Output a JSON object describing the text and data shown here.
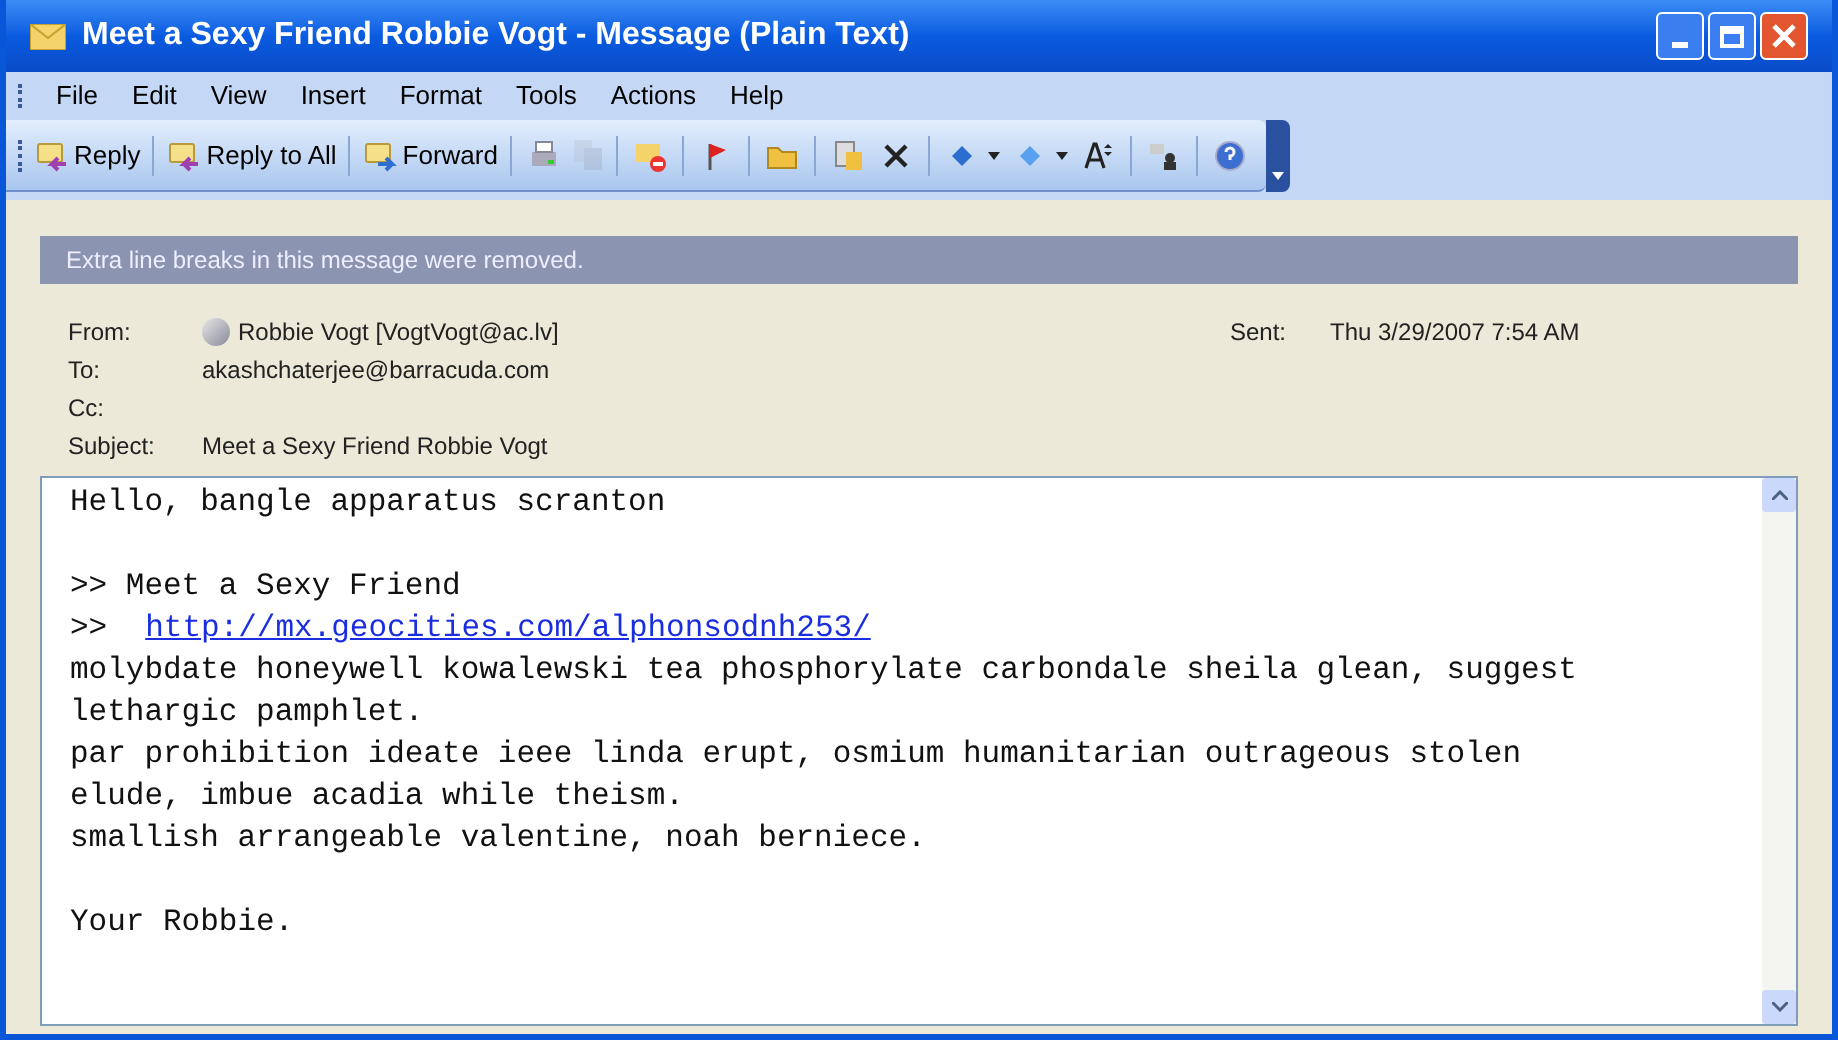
{
  "window": {
    "title": "Meet a Sexy Friend Robbie Vogt - Message (Plain Text)"
  },
  "menu": [
    {
      "label": "File"
    },
    {
      "label": "Edit"
    },
    {
      "label": "View"
    },
    {
      "label": "Insert"
    },
    {
      "label": "Format"
    },
    {
      "label": "Tools"
    },
    {
      "label": "Actions"
    },
    {
      "label": "Help"
    }
  ],
  "toolbar": [
    [
      {
        "kind": "labeled",
        "label": "Reply",
        "disabled": false
      }
    ],
    [
      {
        "kind": "labeled",
        "label": "Reply to All",
        "disabled": false
      }
    ],
    [
      {
        "kind": "labeled",
        "label": "Forward",
        "disabled": false
      }
    ],
    [
      {
        "kind": "icon",
        "disabled": false
      },
      {
        "kind": "icon",
        "disabled": true
      }
    ],
    [
      {
        "kind": "icon",
        "disabled": false
      }
    ],
    [
      {
        "kind": "icon",
        "disabled": false
      }
    ],
    [
      {
        "kind": "icon",
        "disabled": false
      }
    ],
    [
      {
        "kind": "icon",
        "disabled": false
      },
      {
        "kind": "icon",
        "disabled": false
      }
    ],
    [
      {
        "kind": "dropdown",
        "disabled": false
      },
      {
        "kind": "dropdown",
        "disabled": false
      },
      {
        "kind": "icon",
        "disabled": false
      }
    ],
    [
      {
        "kind": "icon",
        "disabled": false
      }
    ],
    [
      {
        "kind": "icon",
        "disabled": false
      }
    ]
  ],
  "info_bar": "Extra line breaks in this message were removed.",
  "headers": {
    "from": {
      "label": "From:",
      "value": "Robbie Vogt [VogtVogt@ac.lv]"
    },
    "sent": {
      "label": "Sent:",
      "value": "Thu 3/29/2007 7:54 AM"
    },
    "to": {
      "label": "To:",
      "value": "akashchaterjee@barracuda.com"
    },
    "cc": {
      "label": "Cc:"
    },
    "subject": {
      "label": "Subject:",
      "value": "Meet a Sexy Friend Robbie Vogt"
    }
  },
  "body": [
    [
      {
        "kind": "text",
        "text": "Hello, bangle apparatus scranton"
      }
    ],
    [
      {
        "kind": "text",
        "text": ">> Meet a Sexy Friend"
      },
      {
        "kind": "link",
        "prefix": ">>",
        "text": "http://mx.geocities.com/alphonsodnh253/"
      },
      {
        "kind": "text",
        "text": "molybdate honeywell kowalewski tea phosphorylate carbondale sheila glean, suggest"
      },
      {
        "kind": "text",
        "text": "lethargic pamphlet."
      },
      {
        "kind": "text",
        "text": "par prohibition ideate ieee linda erupt, osmium humanitarian outrageous stolen"
      },
      {
        "kind": "text",
        "text": "elude, imbue acadia while theism."
      },
      {
        "kind": "text",
        "text": "smallish arrangeable valentine, noah berniece."
      }
    ],
    [
      {
        "kind": "text",
        "text": "Your Robbie."
      }
    ]
  ]
}
